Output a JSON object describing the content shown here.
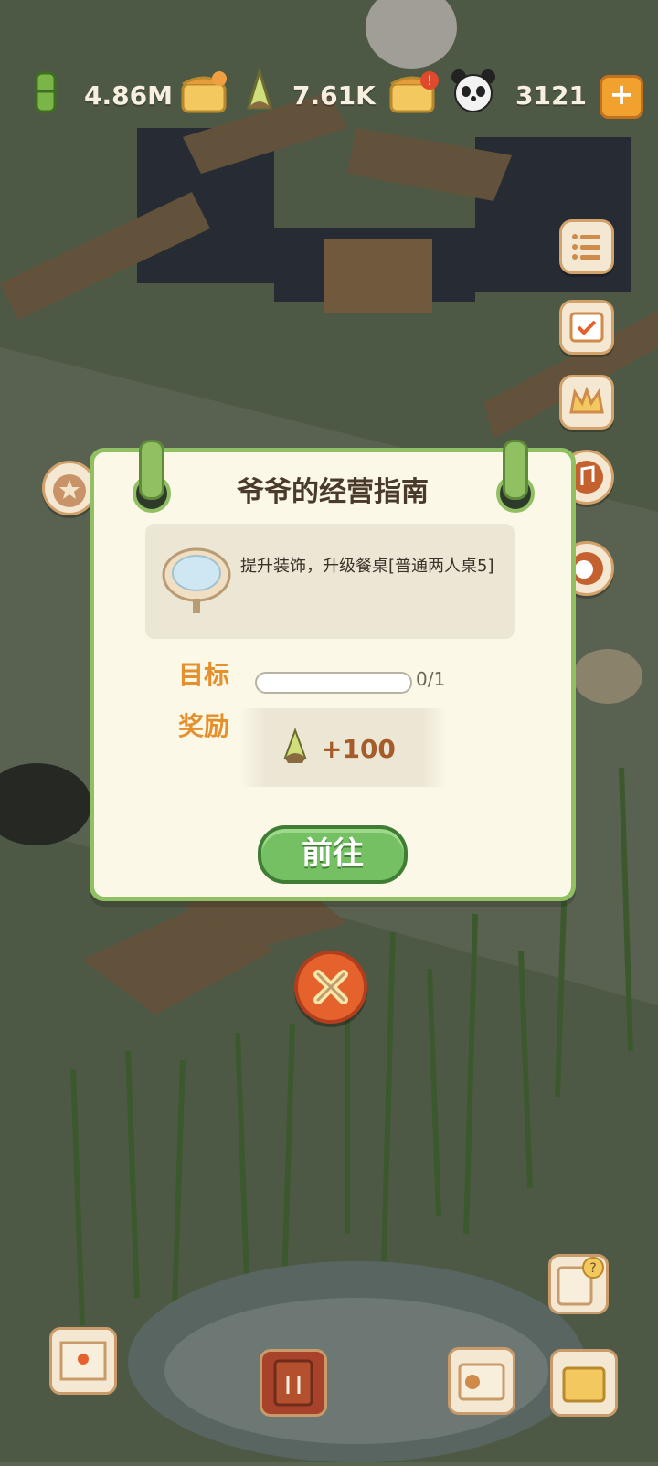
{
  "resources": {
    "bamboo": "4.86M",
    "shoots": "7.61K",
    "pandas": "3121",
    "plus_label": "+"
  },
  "dialog": {
    "title": "爷爷的经营指南",
    "task_description": "提升装饰，升级餐桌[普通两人桌5]",
    "goal_label": "目标",
    "progress_text": "0/1",
    "progress_fraction": 0,
    "reward_label": "奖励",
    "reward_value": "+100",
    "go_button": "前往"
  },
  "icons": {
    "bamboo": "bamboo-icon",
    "shop": "shop-icon",
    "shoot": "bamboo-shoot-icon",
    "panda": "panda-icon",
    "close": "close-icon"
  },
  "colors": {
    "dialog_border": "#91c063",
    "label_orange": "#e6902d",
    "go_button": "#74c062",
    "close_button": "#e6622c"
  }
}
